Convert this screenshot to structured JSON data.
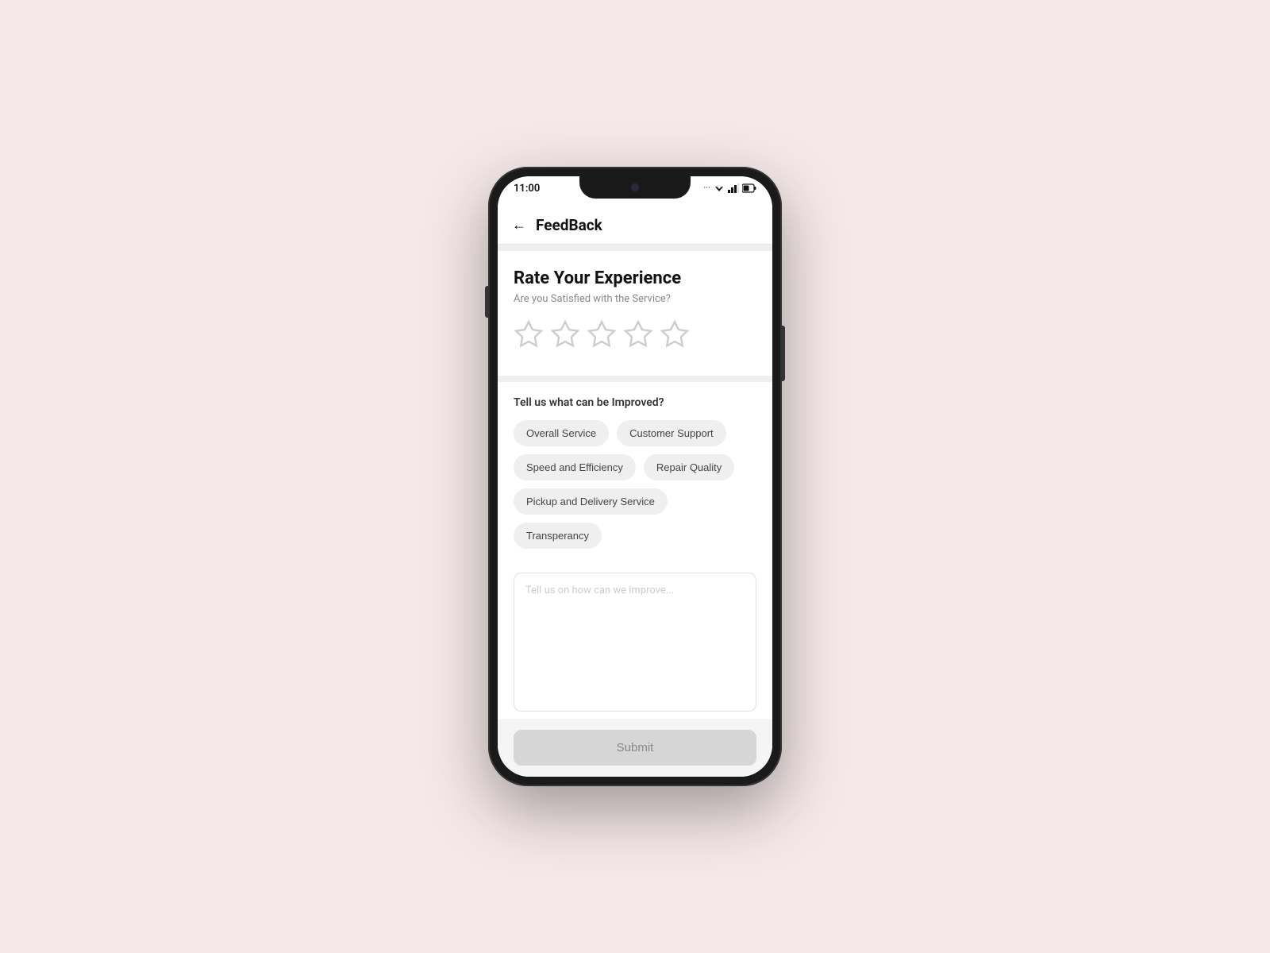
{
  "status_bar": {
    "time": "11:00",
    "icons": "... ▼ ■"
  },
  "header": {
    "back_label": "←",
    "title": "FeedBack"
  },
  "rate_section": {
    "title": "Rate Your Experience",
    "subtitle": "Are you Satisfied with the Service?",
    "stars": [
      "☆",
      "☆",
      "☆",
      "☆",
      "☆"
    ]
  },
  "improve_section": {
    "title": "Tell us what can be Improved?",
    "chips": [
      "Overall Service",
      "Customer Support",
      "Speed and Efficiency",
      "Repair Quality",
      "Pickup and Delivery Service",
      "Transperancy"
    ]
  },
  "textarea": {
    "placeholder": "Tell us on how can we improve..."
  },
  "submit": {
    "label": "Submit"
  }
}
